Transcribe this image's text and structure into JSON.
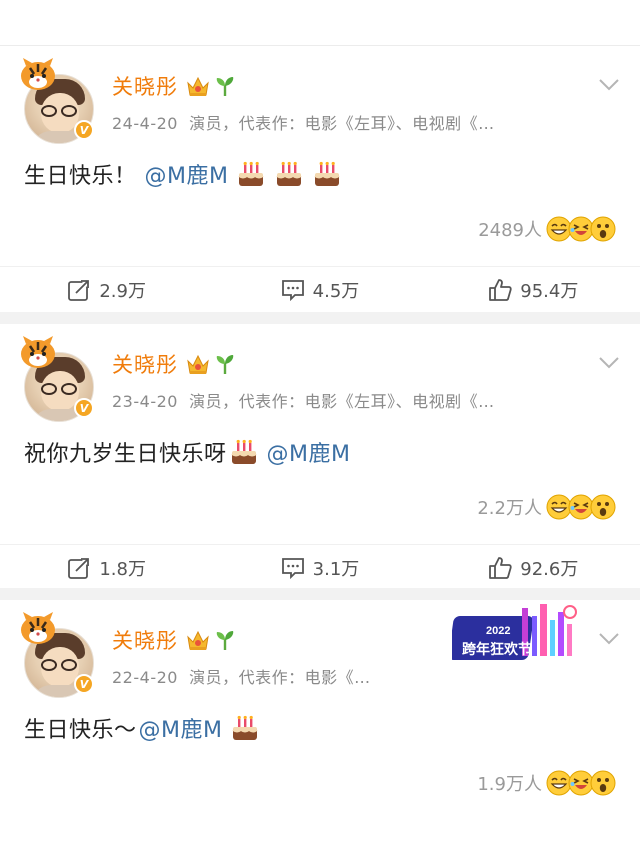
{
  "accent_color": "#f07c0b",
  "mention_color": "#3b6fa3",
  "posts": [
    {
      "username": "关晓彤",
      "date": "24-4-20",
      "bio": "演员，代表作：电影《左耳》、电视剧《…",
      "text": "生日快乐！",
      "mention": "@M鹿M",
      "cakes": 3,
      "reaction_count": "2489人",
      "repost": "2.9万",
      "comment": "4.5万",
      "like": "95.4万"
    },
    {
      "username": "关晓彤",
      "date": "23-4-20",
      "bio": "演员，代表作：电影《左耳》、电视剧《…",
      "text": "祝你九岁生日快乐呀",
      "mention": "@M鹿M",
      "cakes": 1,
      "reaction_count": "2.2万人",
      "repost": "1.8万",
      "comment": "3.1万",
      "like": "92.6万"
    },
    {
      "username": "关晓彤",
      "date": "22-4-20",
      "bio": "演员，代表作：电影《…",
      "text": "生日快乐～",
      "mention": "@M鹿M",
      "cakes": 1,
      "reaction_count": "1.9万人",
      "event_badge": "2022 跨年狂欢节"
    }
  ],
  "icons": [
    "tiger-icon",
    "verified-v-icon",
    "crown-icon",
    "sprout-icon",
    "chevron-down-icon",
    "cake-emoji-icon",
    "grin-emoji-icon",
    "laugh-emoji-icon",
    "wow-emoji-icon",
    "repost-icon",
    "comment-icon",
    "like-icon"
  ]
}
